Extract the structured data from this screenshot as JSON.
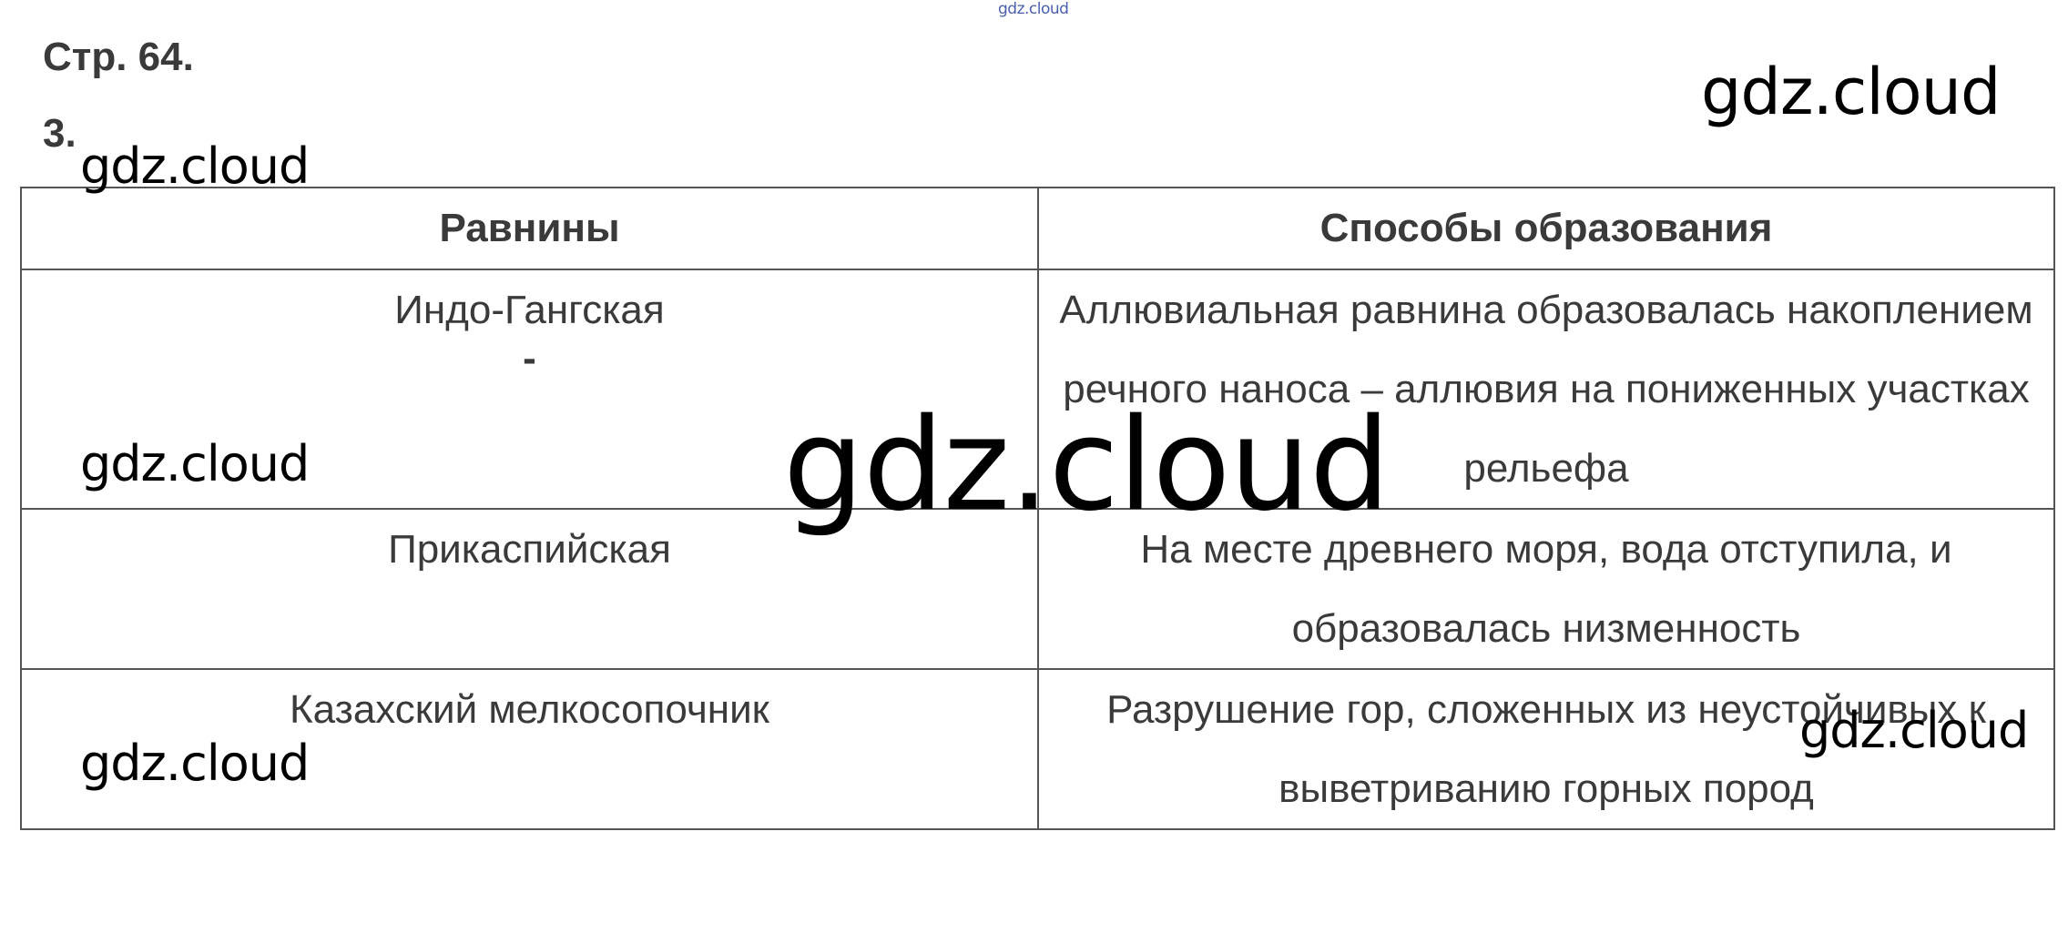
{
  "source_mark": "gdz.cloud",
  "page_label": "Стр. 64.",
  "task_label": "3.",
  "table": {
    "headers": [
      "Равнины",
      "Способы образования"
    ],
    "rows": [
      {
        "plain": "Индо-Гангская",
        "plain_extra": "-",
        "formation": "Аллювиальная равнина образовалась накоплением речного наноса – аллювия на пониженных участках рельефа"
      },
      {
        "plain": "Прикаспийская",
        "formation": "На месте древнего моря, вода отступила, и образовалась низменность"
      },
      {
        "plain": "Казахский мелкосопочник",
        "formation": "Разрушение гор, сложенных из неустойчивых к выветриванию горных пород"
      }
    ]
  },
  "watermarks": {
    "big": "gdz.cloud",
    "top_right": "gdz.cloud",
    "left_1": "gdz.cloud",
    "left_2": "gdz.cloud",
    "left_3": "gdz.cloud",
    "right_3": "gdz.cloud"
  }
}
